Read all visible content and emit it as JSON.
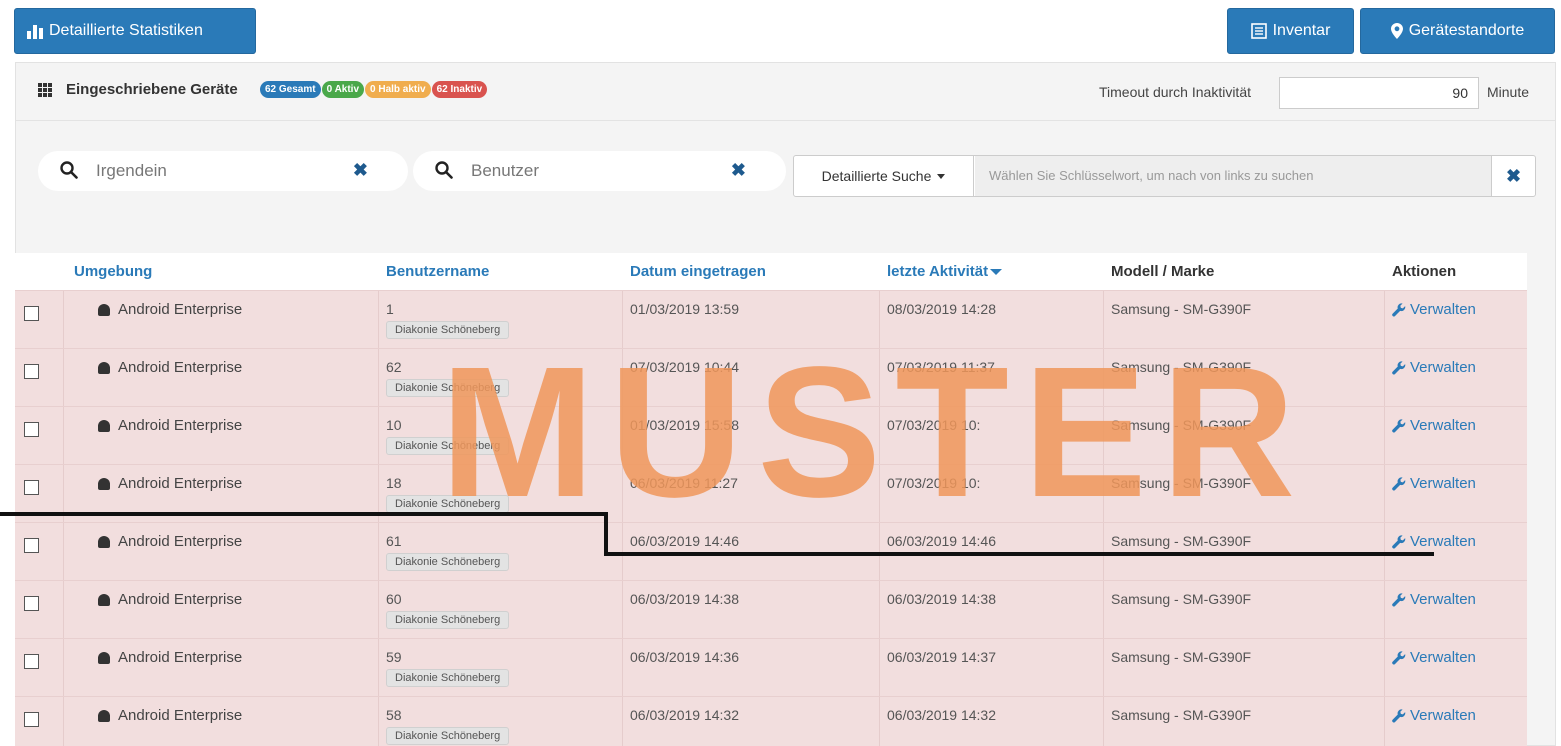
{
  "toolbar": {
    "stats_label": "Detaillierte Statistiken",
    "inventory_label": "Inventar",
    "locations_label": "Gerätestandorte"
  },
  "panel": {
    "title": "Eingeschriebene Geräte",
    "badges": {
      "total": "62 Gesamt",
      "active": "0 Aktiv",
      "half_active": "0 Halb aktiv",
      "inactive": "62 Inaktiv"
    },
    "timeout_label": "Timeout durch Inaktivität",
    "timeout_value": "90",
    "timeout_unit": "Minute"
  },
  "search": {
    "any_placeholder": "Irgendein",
    "user_placeholder": "Benutzer",
    "advanced_label": "Detaillierte Suche",
    "advanced_placeholder": "Wählen Sie Schlüsselwort, um nach von links zu suchen"
  },
  "table": {
    "headers": {
      "environment": "Umgebung",
      "username": "Benutzername",
      "enrolled": "Datum eingetragen",
      "last_activity": "letzte Aktivität",
      "model": "Modell / Marke",
      "actions": "Aktionen"
    },
    "rows": [
      {
        "env": "Android Enterprise",
        "user": "1",
        "group": "Diakonie Schöneberg",
        "enrolled": "01/03/2019 13:59",
        "last": "08/03/2019 14:28",
        "model": "Samsung - SM-G390F",
        "action": "Verwalten"
      },
      {
        "env": "Android Enterprise",
        "user": "62",
        "group": "Diakonie Schöneberg",
        "enrolled": "07/03/2019 10:44",
        "last": "07/03/2019 11:37",
        "model": "Samsung - SM-G390F",
        "action": "Verwalten"
      },
      {
        "env": "Android Enterprise",
        "user": "10",
        "group": "Diakonie Schöneberg",
        "enrolled": "01/03/2019 15:58",
        "last": "07/03/2019 10:",
        "model": "Samsung - SM-G390F",
        "action": "Verwalten"
      },
      {
        "env": "Android Enterprise",
        "user": "18",
        "group": "Diakonie Schöneberg",
        "enrolled": "06/03/2019 11:27",
        "last": "07/03/2019 10:",
        "model": "Samsung - SM-G390F",
        "action": "Verwalten"
      },
      {
        "env": "Android Enterprise",
        "user": "61",
        "group": "Diakonie Schöneberg",
        "enrolled": "06/03/2019 14:46",
        "last": "06/03/2019 14:46",
        "model": "Samsung - SM-G390F",
        "action": "Verwalten"
      },
      {
        "env": "Android Enterprise",
        "user": "60",
        "group": "Diakonie Schöneberg",
        "enrolled": "06/03/2019 14:38",
        "last": "06/03/2019 14:38",
        "model": "Samsung - SM-G390F",
        "action": "Verwalten"
      },
      {
        "env": "Android Enterprise",
        "user": "59",
        "group": "Diakonie Schöneberg",
        "enrolled": "06/03/2019 14:36",
        "last": "06/03/2019 14:37",
        "model": "Samsung - SM-G390F",
        "action": "Verwalten"
      },
      {
        "env": "Android Enterprise",
        "user": "58",
        "group": "Diakonie Schöneberg",
        "enrolled": "06/03/2019 14:32",
        "last": "06/03/2019 14:32",
        "model": "Samsung - SM-G390F",
        "action": "Verwalten"
      }
    ]
  },
  "watermark": "MUSTER"
}
